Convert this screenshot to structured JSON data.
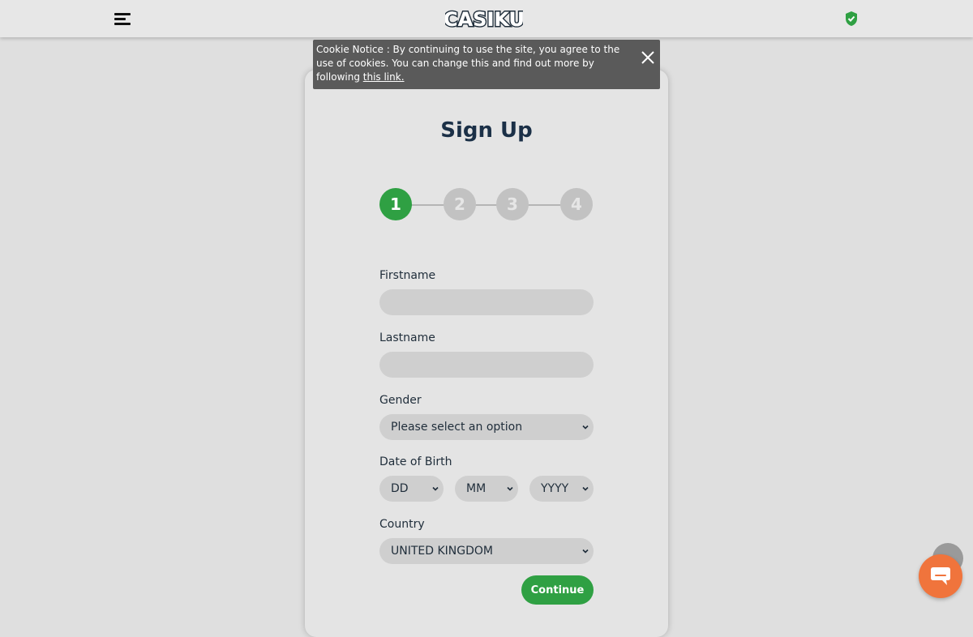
{
  "header": {
    "logo_text": "CASIKU",
    "menu_icon": "hamburger-menu-icon",
    "shield_icon": "shield-check-icon",
    "brand_green": "#2fa043"
  },
  "cookie": {
    "text": "Cookie Notice : By continuing to use the site, you agree to the use of cookies. You can change this and find out more by following ",
    "link_text": "this link.",
    "close_icon": "close-icon"
  },
  "signup": {
    "title": "Sign Up",
    "steps": [
      {
        "label": "1",
        "active": true
      },
      {
        "label": "2",
        "active": false
      },
      {
        "label": "3",
        "active": false
      },
      {
        "label": "4",
        "active": false
      }
    ],
    "firstname_label": "Firstname",
    "firstname_value": "",
    "lastname_label": "Lastname",
    "lastname_value": "",
    "gender_label": "Gender",
    "gender_value": "Please select an option",
    "dob_label": "Date of Birth",
    "dob_day": "DD",
    "dob_month": "MM",
    "dob_year": "YYYY",
    "country_label": "Country",
    "country_value": "UNITED KINGDOM",
    "continue_label": "Continue"
  },
  "floating": {
    "chat_icon": "chat-bubble-icon",
    "chat_color": "#f0743c",
    "scroll_icon": "scroll-to-top-icon"
  }
}
